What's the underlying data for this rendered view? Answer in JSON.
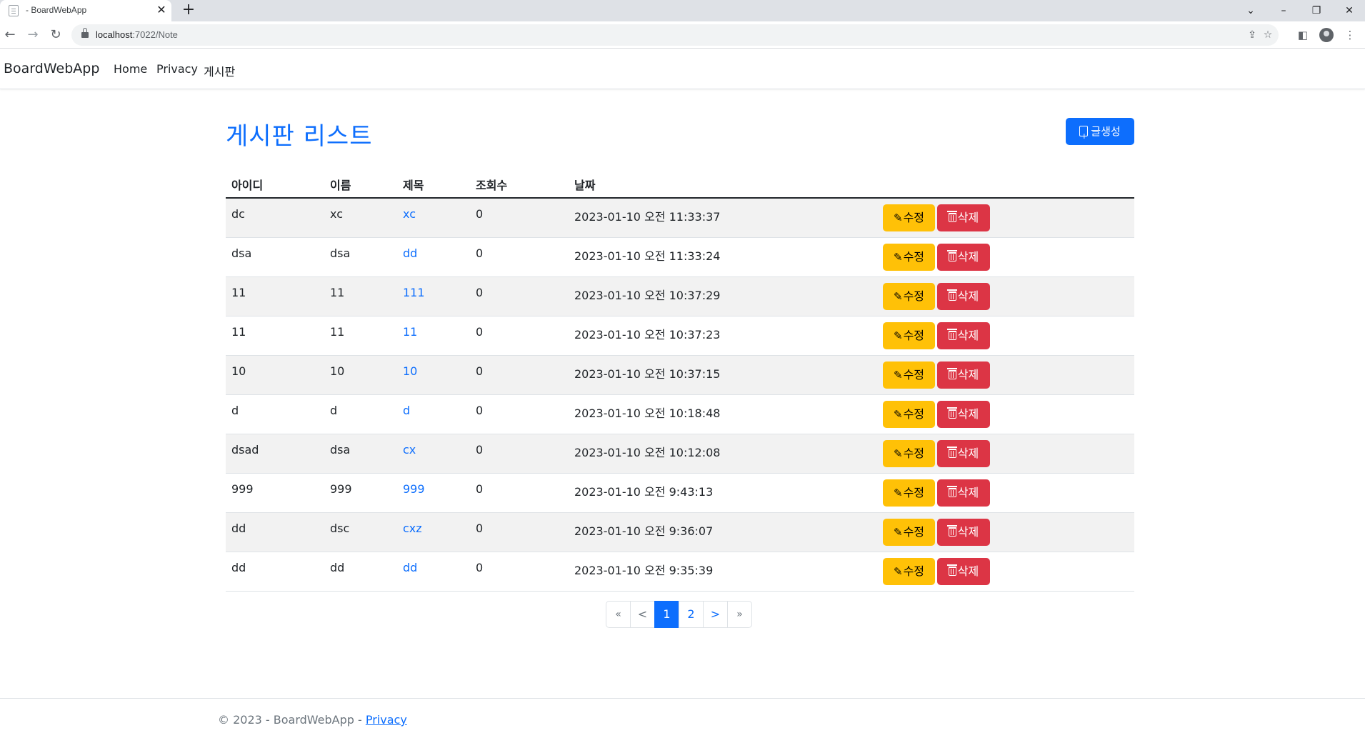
{
  "browser": {
    "tab_title": "- BoardWebApp",
    "url_host": "localhost",
    "url_path": ":7022/Note"
  },
  "nav": {
    "brand": "BoardWebApp",
    "links": [
      "Home",
      "Privacy",
      "게시판"
    ]
  },
  "page": {
    "title": "게시판 리스트",
    "create_button": "글생성"
  },
  "table": {
    "headers": [
      "아이디",
      "이름",
      "제목",
      "조회수",
      "날짜"
    ],
    "edit_label": "수정",
    "delete_label": "삭제",
    "rows": [
      {
        "id": "dc",
        "name": "xc",
        "title": "xc",
        "views": "0",
        "date": "2023-01-10 오전 11:33:37"
      },
      {
        "id": "dsa",
        "name": "dsa",
        "title": "dd",
        "views": "0",
        "date": "2023-01-10 오전 11:33:24"
      },
      {
        "id": "11",
        "name": "11",
        "title": "111",
        "views": "0",
        "date": "2023-01-10 오전 10:37:29"
      },
      {
        "id": "11",
        "name": "11",
        "title": "11",
        "views": "0",
        "date": "2023-01-10 오전 10:37:23"
      },
      {
        "id": "10",
        "name": "10",
        "title": "10",
        "views": "0",
        "date": "2023-01-10 오전 10:37:15"
      },
      {
        "id": "d",
        "name": "d",
        "title": "d",
        "views": "0",
        "date": "2023-01-10 오전 10:18:48"
      },
      {
        "id": "dsad",
        "name": "dsa",
        "title": "cx",
        "views": "0",
        "date": "2023-01-10 오전 10:12:08"
      },
      {
        "id": "999",
        "name": "999",
        "title": "999",
        "views": "0",
        "date": "2023-01-10 오전 9:43:13"
      },
      {
        "id": "dd",
        "name": "dsc",
        "title": "cxz",
        "views": "0",
        "date": "2023-01-10 오전 9:36:07"
      },
      {
        "id": "dd",
        "name": "dd",
        "title": "dd",
        "views": "0",
        "date": "2023-01-10 오전 9:35:39"
      }
    ]
  },
  "pagination": {
    "first": "«",
    "prev": "<",
    "pages": [
      "1",
      "2"
    ],
    "current": "1",
    "next": ">",
    "last": "»"
  },
  "footer": {
    "text": "© 2023 - BoardWebApp - ",
    "link": "Privacy"
  },
  "colors": {
    "primary": "#0d6efd",
    "warning": "#ffc107",
    "danger": "#dc3545"
  }
}
